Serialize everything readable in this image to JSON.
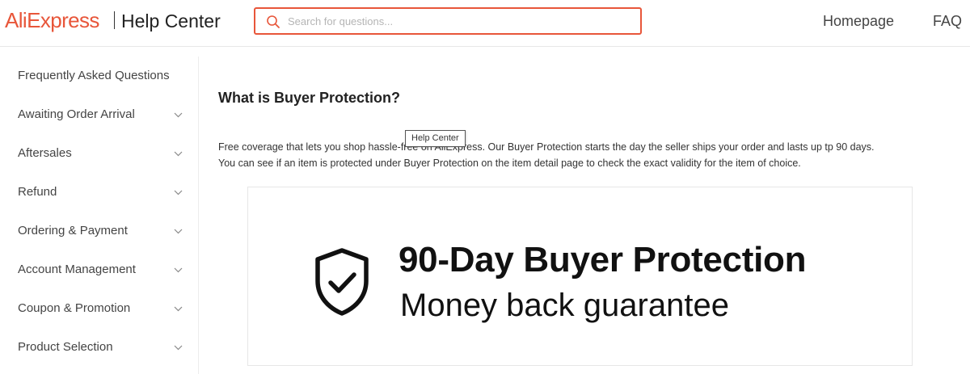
{
  "header": {
    "logo_text": "AliExpress",
    "section_title": "Help Center",
    "search": {
      "placeholder": "Search for questions...",
      "value": ""
    },
    "nav": [
      {
        "label": "Homepage"
      },
      {
        "label": "FAQ"
      }
    ]
  },
  "sidebar": {
    "items": [
      {
        "label": "Frequently Asked Questions",
        "expandable": false
      },
      {
        "label": "Awaiting Order Arrival",
        "expandable": true
      },
      {
        "label": "Aftersales",
        "expandable": true
      },
      {
        "label": "Refund",
        "expandable": true
      },
      {
        "label": "Ordering & Payment",
        "expandable": true
      },
      {
        "label": "Account Management",
        "expandable": true
      },
      {
        "label": "Coupon & Promotion",
        "expandable": true
      },
      {
        "label": "Product Selection",
        "expandable": true
      }
    ]
  },
  "article": {
    "title": "What is Buyer Protection?",
    "line1": "Free coverage that lets you shop hassle-free on AliExpress. Our Buyer Protection starts the day the seller ships your order and lasts up tp 90 days.",
    "line2": "You can see if an item is protected under Buyer Protection on the item detail page to check the exact validity for the item of choice."
  },
  "tooltip": {
    "text": "Help Center"
  },
  "banner": {
    "title": "90-Day Buyer Protection",
    "subtitle": "Money back guarantee",
    "icon": "shield-check-icon"
  },
  "colors": {
    "brand": "#e8563a",
    "text": "#333333",
    "border": "#e8e8e8"
  }
}
